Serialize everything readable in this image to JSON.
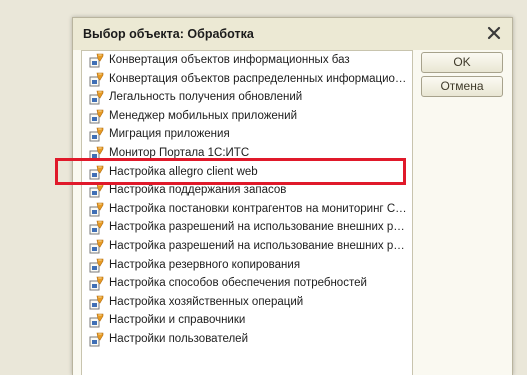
{
  "window": {
    "title": "Выбор объекта: Обработка"
  },
  "buttons": {
    "ok_label": "OK",
    "cancel_label": "Отмена"
  },
  "icons": {
    "close": "close-icon",
    "row": "processing-object-icon"
  },
  "colors": {
    "highlight": "#e0192a",
    "icon_orange": "#e79a23",
    "icon_blue": "#3f6fb6"
  },
  "list": {
    "items": [
      {
        "label": "Конвертация объектов информационных баз"
      },
      {
        "label": "Конвертация объектов распределенных информационных баз"
      },
      {
        "label": "Легальность получения обновлений"
      },
      {
        "label": "Менеджер мобильных приложений"
      },
      {
        "label": "Миграция приложения"
      },
      {
        "label": "Монитор Портала 1С:ИТС"
      },
      {
        "label": "Настройка allegro client web"
      },
      {
        "label": "Настройка поддержания запасов"
      },
      {
        "label": "Настройка постановки контрагентов на мониторинг СПАРК"
      },
      {
        "label": "Настройка разрешений на использование внешних ресурсов"
      },
      {
        "label": "Настройка разрешений на использование внешних ресурсов"
      },
      {
        "label": "Настройка резервного копирования"
      },
      {
        "label": "Настройка способов обеспечения потребностей"
      },
      {
        "label": "Настройка хозяйственных операций"
      },
      {
        "label": "Настройки и справочники"
      },
      {
        "label": "Настройки пользователей"
      }
    ]
  }
}
